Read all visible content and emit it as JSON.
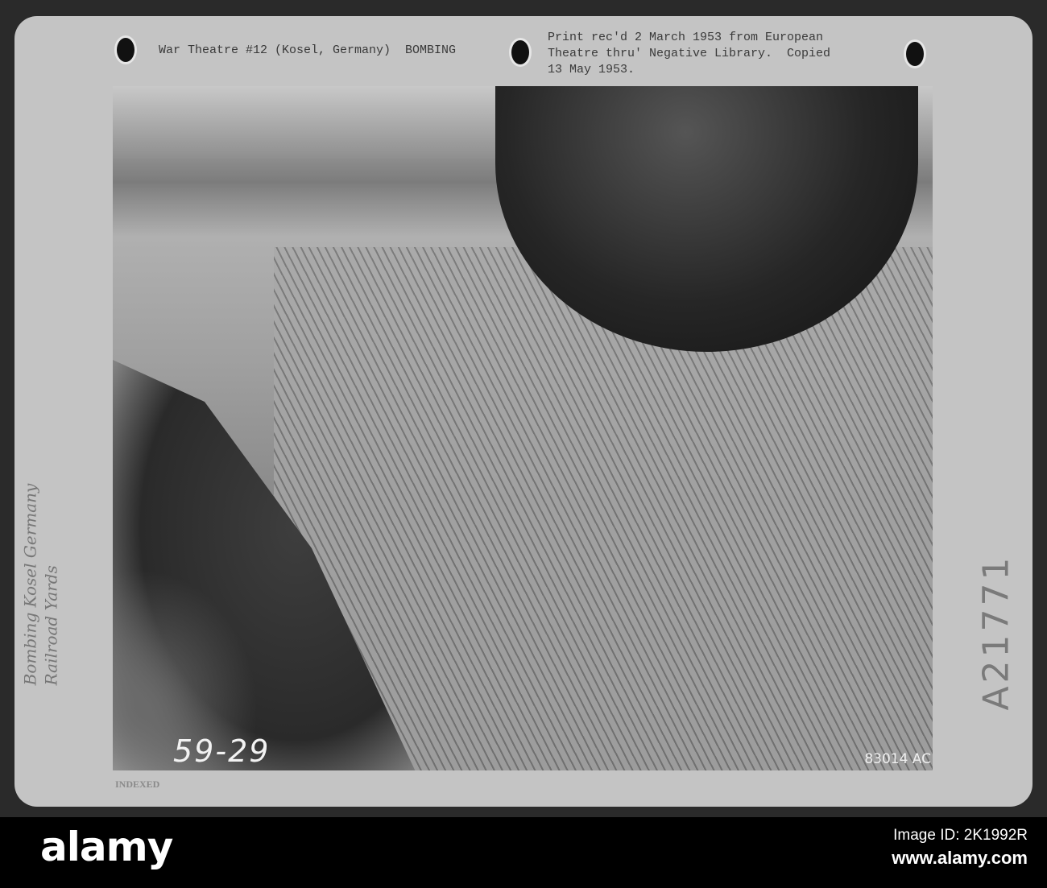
{
  "card": {
    "caption_left": "War Theatre #12 (Kosel, Germany)  BOMBING",
    "caption_right": "Print rec'd 2 March 1953 from European\nTheatre thru' Negative Library.  Copied\n13 May 1953.",
    "negative_number": "59-29",
    "photo_id": "83014 AC",
    "stamp": "INDEXED",
    "handwritten_left": "Bombing Kosel Germany\nRailroad Yards",
    "handwritten_right": "A21771"
  },
  "footer": {
    "logo": "alamy",
    "image_id": "Image ID: 2K1992R",
    "website": "www.alamy.com"
  }
}
